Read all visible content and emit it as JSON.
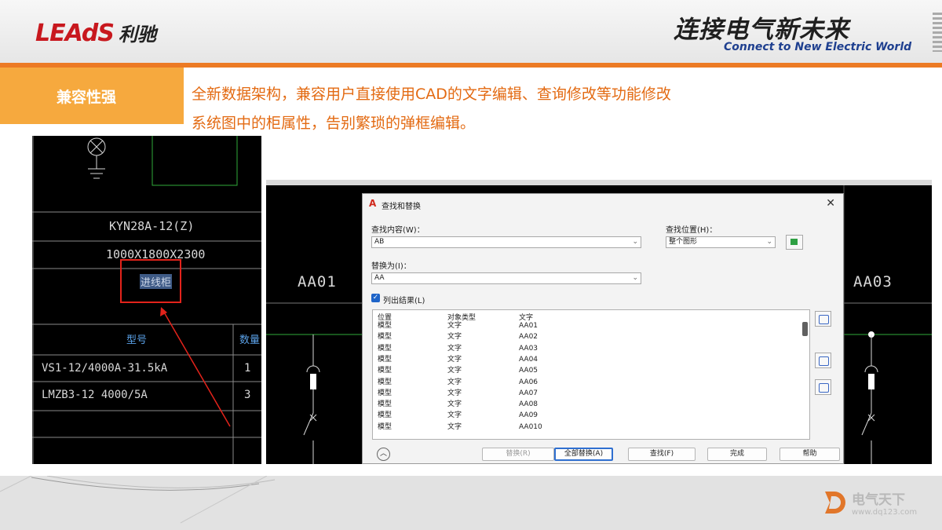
{
  "header": {
    "logo_en": "LEAdS",
    "logo_cn": "利驰",
    "slogan_cn": "连接电气新未来",
    "slogan_en": "Connect to New Electric World"
  },
  "feature": {
    "tag": "兼容性强",
    "line1": "全新数据架构，兼容用户直接使用CAD的文字编辑、查询修改等功能修改",
    "line2": "系统图中的柜属性，告别繁琐的弹框编辑。"
  },
  "cad_left": {
    "cabinet_model": "KYN28A-12(Z)",
    "cabinet_size": "1000X1800X2300",
    "selected_name": "进线柜",
    "table_header_model": "型号",
    "table_header_qty": "数量",
    "rows": [
      {
        "model": "VS1-12/4000A-31.5kA",
        "qty": "1"
      },
      {
        "model": "LMZB3-12 4000/5A",
        "qty": "3"
      }
    ]
  },
  "cad_right": {
    "label_left": "AA01",
    "label_right": "AA03"
  },
  "dialog": {
    "title": "查找和替换",
    "find_label": "查找内容(W)：",
    "find_value": "AB",
    "where_label": "查找位置(H)：",
    "where_value": "整个图形",
    "replace_label": "替换为(I)：",
    "replace_value": "AA",
    "list_results_label": "列出结果(L)",
    "columns": [
      "位置",
      "对象类型",
      "文字"
    ],
    "results": [
      {
        "loc": "模型",
        "type": "文字",
        "text": "AA01"
      },
      {
        "loc": "模型",
        "type": "文字",
        "text": "AA02"
      },
      {
        "loc": "模型",
        "type": "文字",
        "text": "AA03"
      },
      {
        "loc": "模型",
        "type": "文字",
        "text": "AA04"
      },
      {
        "loc": "模型",
        "type": "文字",
        "text": "AA05"
      },
      {
        "loc": "模型",
        "type": "文字",
        "text": "AA06"
      },
      {
        "loc": "模型",
        "type": "文字",
        "text": "AA07"
      },
      {
        "loc": "模型",
        "type": "文字",
        "text": "AA08"
      },
      {
        "loc": "模型",
        "type": "文字",
        "text": "AA09"
      },
      {
        "loc": "模型",
        "type": "文字",
        "text": "AA010"
      }
    ],
    "buttons": {
      "replace": "替换(R)",
      "replace_all": "全部替换(A)",
      "find": "查找(F)",
      "done": "完成",
      "help": "帮助"
    }
  },
  "watermark": {
    "name": "电气天下",
    "url": "www.dq123.com"
  }
}
